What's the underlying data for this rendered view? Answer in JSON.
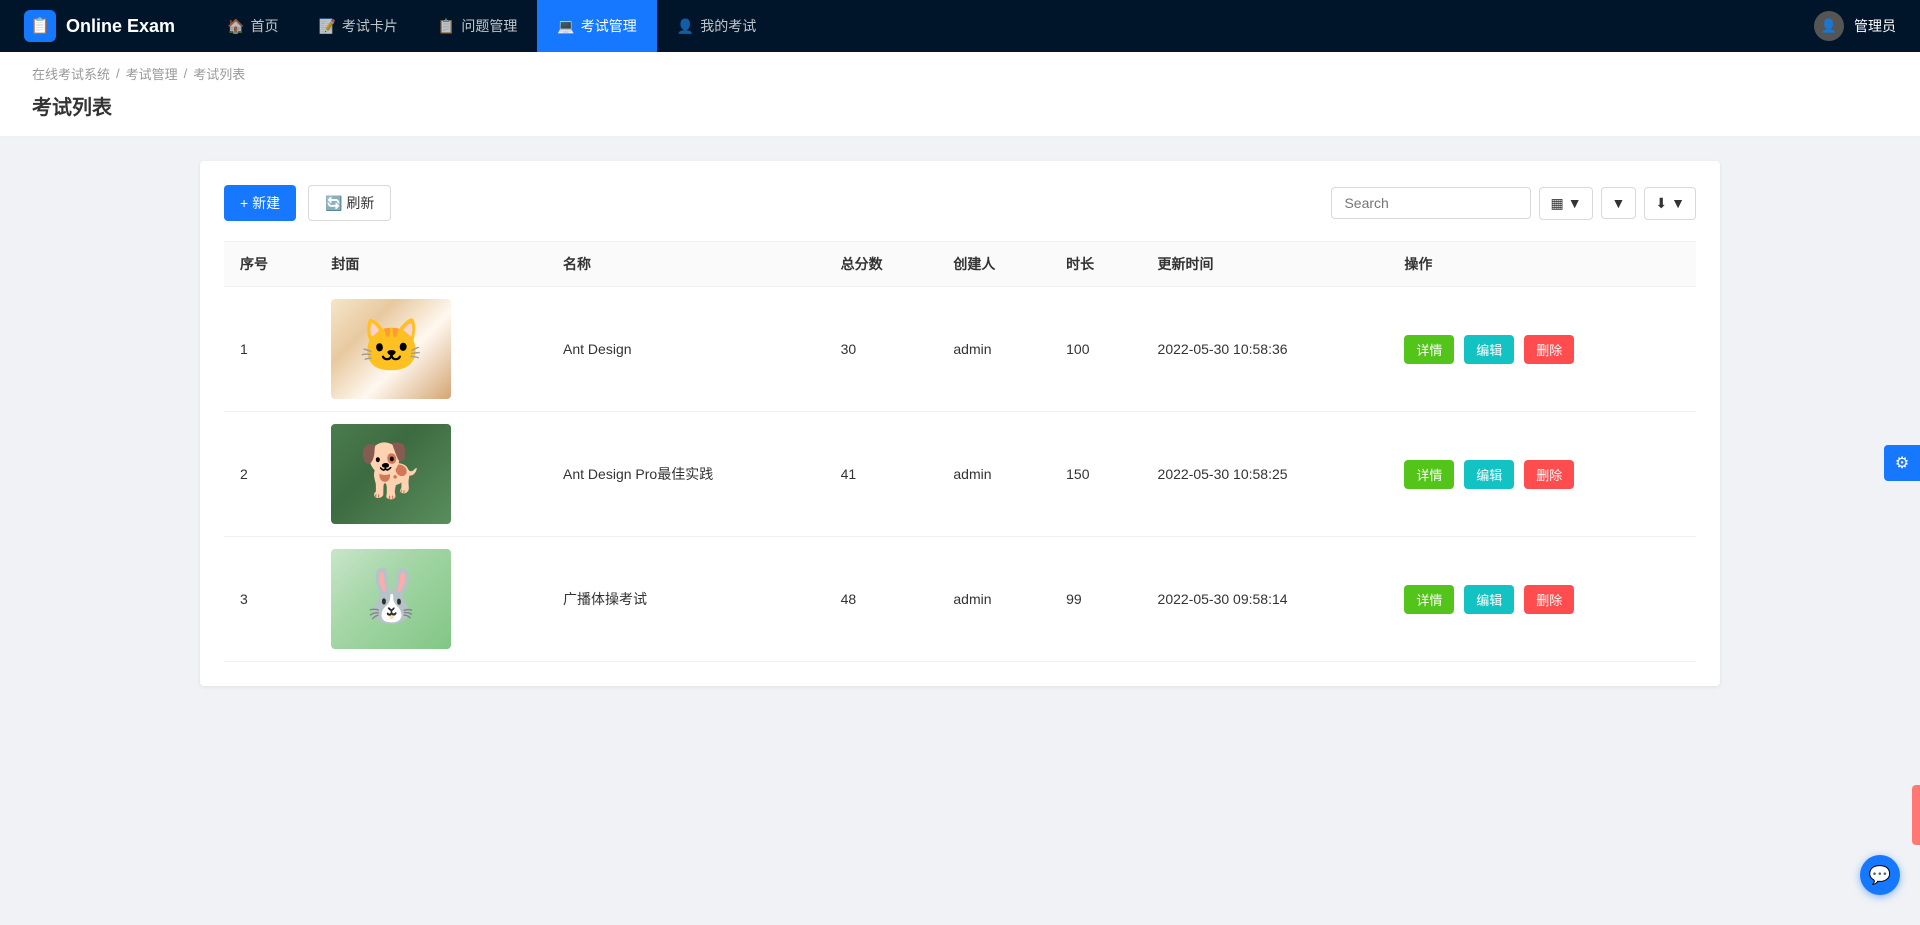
{
  "app": {
    "brand_icon": "📋",
    "brand_name": "Online Exam"
  },
  "nav": {
    "items": [
      {
        "id": "home",
        "label": "首页",
        "icon": "🏠",
        "active": false
      },
      {
        "id": "flashcard",
        "label": "考试卡片",
        "icon": "📝",
        "active": false
      },
      {
        "id": "questions",
        "label": "问题管理",
        "icon": "📋",
        "active": false
      },
      {
        "id": "exam-mgmt",
        "label": "考试管理",
        "icon": "💻",
        "active": true
      },
      {
        "id": "my-exams",
        "label": "我的考试",
        "icon": "👤",
        "active": false
      }
    ],
    "user_label": "管理员"
  },
  "breadcrumb": {
    "items": [
      "在线考试系统",
      "考试管理",
      "考试列表"
    ]
  },
  "page": {
    "title": "考试列表"
  },
  "toolbar": {
    "new_label": "+ 新建",
    "refresh_label": "🔄 刷新",
    "search_placeholder": "Search"
  },
  "table": {
    "columns": [
      "序号",
      "封面",
      "名称",
      "总分数",
      "创建人",
      "时长",
      "更新时间",
      "操作"
    ],
    "rows": [
      {
        "index": 1,
        "cover_type": "cat",
        "name": "Ant Design",
        "total_score": 30,
        "creator": "admin",
        "duration": 100,
        "updated_at": "2022-05-30 10:58:36"
      },
      {
        "index": 2,
        "cover_type": "dog",
        "name": "Ant Design Pro最佳实践",
        "total_score": 41,
        "creator": "admin",
        "duration": 150,
        "updated_at": "2022-05-30 10:58:25"
      },
      {
        "index": 3,
        "cover_type": "rabbit",
        "name": "广播体操考试",
        "total_score": 48,
        "creator": "admin",
        "duration": 99,
        "updated_at": "2022-05-30 09:58:14"
      }
    ],
    "action_labels": {
      "detail": "详情",
      "edit": "编辑",
      "delete": "删除"
    }
  }
}
